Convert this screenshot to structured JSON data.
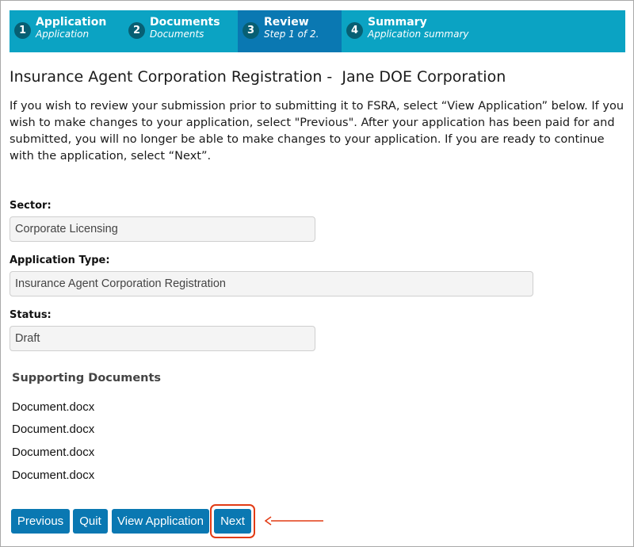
{
  "stepper": {
    "steps": [
      {
        "number": "1",
        "title": "Application",
        "subtitle": "Application"
      },
      {
        "number": "2",
        "title": "Documents",
        "subtitle": "Documents"
      },
      {
        "number": "3",
        "title": "Review",
        "subtitle": "Step 1 of 2."
      },
      {
        "number": "4",
        "title": "Summary",
        "subtitle": "Application summary"
      }
    ],
    "active_step": 3
  },
  "page": {
    "heading": "Insurance Agent Corporation Registration -  Jane DOE Corporation",
    "intro": "If you wish to review your submission prior to submitting it to FSRA, select “View Application” below. If you wish to make changes to your application, select \"Previous\". After your application has been paid for and submitted, you will no longer be able to make changes to your application. If you are ready to continue with the application, select “Next”."
  },
  "form": {
    "sector_label": "Sector:",
    "sector_value": "Corporate Licensing",
    "application_type_label": "Application Type:",
    "application_type_value": "Insurance Agent Corporation Registration",
    "status_label": "Status:",
    "status_value": "Draft"
  },
  "supporting_documents": {
    "title": "Supporting Documents",
    "items": [
      "Document.docx",
      "Document.docx",
      "Document.docx",
      "Document.docx"
    ]
  },
  "actions": {
    "previous": "Previous",
    "quit": "Quit",
    "view_application": "View Application",
    "next": "Next"
  },
  "colors": {
    "stepper_bg": "#0ba3c3",
    "active_step_bg": "#0a78b2",
    "button_bg": "#0a78b2",
    "highlight": "#e23b14"
  }
}
